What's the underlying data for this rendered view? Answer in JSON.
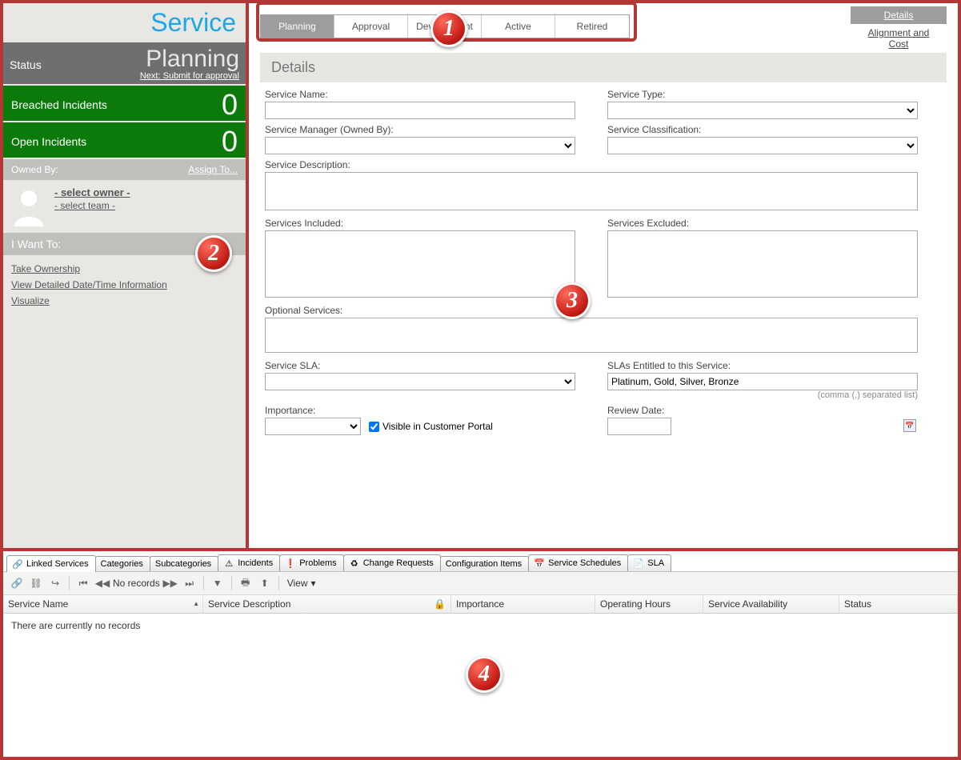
{
  "sidebar": {
    "title": "Service",
    "status_label": "Status",
    "status_value": "Planning",
    "status_next_prefix": "Next:",
    "status_next_link": "Submit for approval",
    "breached_label": "Breached Incidents",
    "breached_count": "0",
    "open_label": "Open Incidents",
    "open_count": "0",
    "owned_by_label": "Owned By:",
    "assign_to": "Assign To...",
    "select_owner": "- select owner -",
    "select_team": "- select team -",
    "iwant_label": "I Want To:",
    "iwant_items": [
      "Take Ownership",
      "View Detailed Date/Time Information",
      "Visualize"
    ]
  },
  "tabs": {
    "items": [
      "Planning",
      "Approval",
      "Development",
      "Active",
      "Retired"
    ],
    "active_index": 0,
    "right_items": [
      "Details",
      "Alignment and Cost"
    ],
    "right_active_index": 0
  },
  "details": {
    "section_title": "Details",
    "labels": {
      "service_name": "Service Name:",
      "service_type": "Service Type:",
      "service_manager": "Service Manager (Owned By):",
      "service_classification": "Service Classification:",
      "service_description": "Service Description:",
      "services_included": "Services Included:",
      "services_excluded": "Services Excluded:",
      "optional_services": "Optional Services:",
      "service_sla": "Service SLA:",
      "slas_entitled": "SLAs Entitled to this Service:",
      "slas_hint": "(comma (,) separated list)",
      "importance": "Importance:",
      "visible_portal": "Visible in Customer Portal",
      "review_date": "Review Date:"
    },
    "values": {
      "service_name": "",
      "service_type": "",
      "service_manager": "",
      "service_classification": "",
      "service_description": "",
      "services_included": "",
      "services_excluded": "",
      "optional_services": "",
      "service_sla": "",
      "slas_entitled": "Platinum, Gold, Silver, Bronze",
      "importance": "",
      "visible_portal_checked": true,
      "review_date": ""
    }
  },
  "bottom": {
    "tabs": [
      "Linked Services",
      "Categories",
      "Subcategories",
      "Incidents",
      "Problems",
      "Change Requests",
      "Configuration Items",
      "Service Schedules",
      "SLA"
    ],
    "active_tab_index": 0,
    "no_records": "No records",
    "view_label": "View",
    "columns": [
      "Service Name",
      "Service Description",
      "Importance",
      "Operating Hours",
      "Service Availability",
      "Status"
    ],
    "empty_text": "There are currently no records"
  },
  "badges": {
    "b1": "1",
    "b2": "2",
    "b3": "3",
    "b4": "4"
  }
}
